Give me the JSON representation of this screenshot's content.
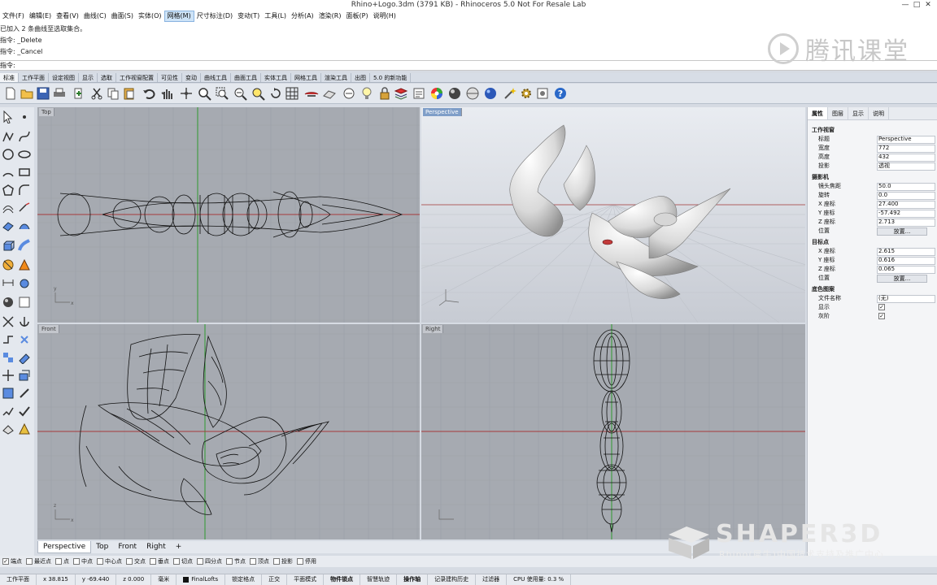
{
  "window": {
    "title": "Rhino+Logo.3dm (3791 KB) - Rhinoceros 5.0 Not For Resale Lab",
    "minimize": "—",
    "maximize": "□",
    "close": "✕"
  },
  "menu": [
    "文件(F)",
    "编辑(E)",
    "查看(V)",
    "曲线(C)",
    "曲面(S)",
    "实体(O)",
    "网格(M)",
    "尺寸标注(D)",
    "变动(T)",
    "工具(L)",
    "分析(A)",
    "渲染(R)",
    "面板(P)",
    "说明(H)"
  ],
  "command_history": [
    "已加入 2 条曲线至选取集合。",
    "指令: _Delete",
    "指令: _Cancel"
  ],
  "command_prompt": "指令:",
  "watermark_top": "腾讯课堂",
  "toolbar_tabs": [
    "标准",
    "工作平面",
    "设定视图",
    "显示",
    "选取",
    "工作视窗配置",
    "可见性",
    "变动",
    "曲线工具",
    "曲面工具",
    "实体工具",
    "网格工具",
    "渲染工具",
    "出图",
    "5.0 的新功能"
  ],
  "toolbar_icons": [
    "new-icon",
    "open-icon",
    "save-icon",
    "print-icon",
    "import-icon",
    "cut-icon",
    "copy-icon",
    "paste-icon",
    "undo-icon",
    "pan-icon",
    "rotate-view-icon",
    "zoom-icon",
    "zoom-window-icon",
    "zoom-extents-icon",
    "zoom-selected-icon",
    "rotate-icon",
    "grid-icon",
    "named-view-icon",
    "plane-icon",
    "snapshot-icon",
    "light-icon",
    "lock-icon",
    "layer-icon",
    "properties-icon",
    "color-wheel-icon",
    "render-sphere-icon",
    "material-icon",
    "render-icon",
    "wand-icon",
    "settings-icon",
    "options-icon",
    "help-icon"
  ],
  "viewports": {
    "top": "Top",
    "perspective": "Perspective",
    "front": "Front",
    "right": "Right"
  },
  "axis": {
    "x": "x",
    "y": "y",
    "z": "z"
  },
  "right_panel": {
    "tabs": [
      "属性",
      "图层",
      "显示",
      "说明"
    ],
    "section_viewport": "工作视窗",
    "rows_viewport": [
      {
        "k": "标题",
        "v": "Perspective"
      },
      {
        "k": "宽度",
        "v": "772"
      },
      {
        "k": "高度",
        "v": "432"
      },
      {
        "k": "投影",
        "v": "透视"
      }
    ],
    "section_camera": "摄影机",
    "rows_camera": [
      {
        "k": "镜头焦距",
        "v": "50.0"
      },
      {
        "k": "旋转",
        "v": "0.0"
      },
      {
        "k": "X 座标",
        "v": "27.400"
      },
      {
        "k": "Y 座标",
        "v": "-57.492"
      },
      {
        "k": "Z 座标",
        "v": "2.713"
      },
      {
        "k": "位置",
        "v": "放置..."
      }
    ],
    "section_target": "目标点",
    "rows_target": [
      {
        "k": "X 座标",
        "v": "2.615"
      },
      {
        "k": "Y 座标",
        "v": "0.616"
      },
      {
        "k": "Z 座标",
        "v": "0.065"
      },
      {
        "k": "位置",
        "v": "放置..."
      }
    ],
    "section_wallpaper": "底色图案",
    "rows_wallpaper": [
      {
        "k": "文件名称",
        "v": "(无)"
      },
      {
        "k": "显示",
        "v": "✓"
      },
      {
        "k": "灰阶",
        "v": "✓"
      }
    ]
  },
  "viewport_tabs": [
    "Perspective",
    "Top",
    "Front",
    "Right",
    "+"
  ],
  "osnaps": [
    {
      "label": "端点",
      "checked": true
    },
    {
      "label": "最近点",
      "checked": false
    },
    {
      "label": "点",
      "checked": false
    },
    {
      "label": "中点",
      "checked": false
    },
    {
      "label": "中心点",
      "checked": false
    },
    {
      "label": "交点",
      "checked": false
    },
    {
      "label": "垂点",
      "checked": false
    },
    {
      "label": "切点",
      "checked": false
    },
    {
      "label": "四分点",
      "checked": false
    },
    {
      "label": "节点",
      "checked": false
    },
    {
      "label": "顶点",
      "checked": false
    },
    {
      "label": "投影",
      "checked": false
    },
    {
      "label": "停用",
      "checked": false
    }
  ],
  "status": {
    "cplane": "工作平面",
    "x": "x 38.815",
    "y": "y -69.440",
    "z": "z 0.000",
    "unit": "毫米",
    "layer": "FinalLofts",
    "toggles": [
      "锁定格点",
      "正交",
      "平面模式",
      "物件锁点",
      "智慧轨迹",
      "操作轴",
      "记录建构历史",
      "过滤器"
    ],
    "cpu": "CPU 使用量: 0.3 %"
  },
  "watermark_bottom": {
    "title": "SHAPER3D",
    "sub": "Rhino(犀牛)中国技术支持及推广中心"
  },
  "colors": {
    "viewport_bg": "#a6aab1",
    "grid": "#9aa0a8",
    "x_axis": "#a63a3a",
    "y_axis": "#2f9a2f",
    "active_label": "#7f9ec8"
  }
}
